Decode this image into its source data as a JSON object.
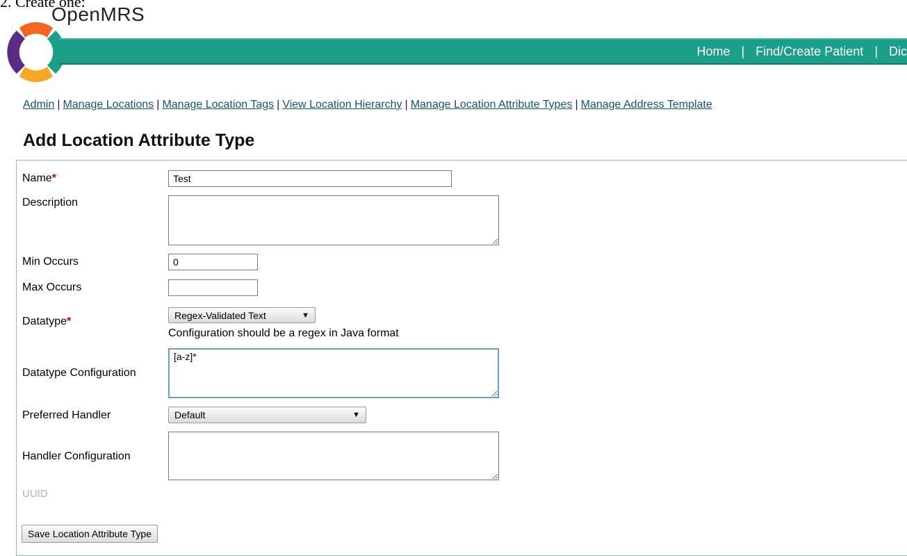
{
  "caption": "2. Create one:",
  "app": {
    "name": "OpenMRS"
  },
  "topnav": {
    "home": "Home",
    "find_create_patient": "Find/Create Patient",
    "dict": "Dic"
  },
  "subnav": [
    {
      "label": "Admin"
    },
    {
      "label": "Manage Locations"
    },
    {
      "label": "Manage Location Tags"
    },
    {
      "label": "View Location Hierarchy"
    },
    {
      "label": "Manage Location Attribute Types"
    },
    {
      "label": "Manage Address Template"
    }
  ],
  "page_title": "Add Location Attribute Type",
  "form": {
    "name_label": "Name",
    "name_value": "Test",
    "description_label": "Description",
    "description_value": "",
    "min_occurs_label": "Min Occurs",
    "min_occurs_value": "0",
    "max_occurs_label": "Max Occurs",
    "max_occurs_value": "",
    "datatype_label": "Datatype",
    "datatype_value": "Regex-Validated Text",
    "datatype_hint": "Configuration should be a regex in Java format",
    "datatype_config_label": "Datatype Configuration",
    "datatype_config_value": "[a-z]*",
    "preferred_handler_label": "Preferred Handler",
    "preferred_handler_value": "Default",
    "handler_config_label": "Handler Configuration",
    "handler_config_value": "",
    "uuid_label": "UUID",
    "required_marker": "*",
    "save_button": "Save Location Attribute Type"
  },
  "colors": {
    "header_bar": "#1aa089",
    "link": "#12537a",
    "required": "#d10000"
  }
}
